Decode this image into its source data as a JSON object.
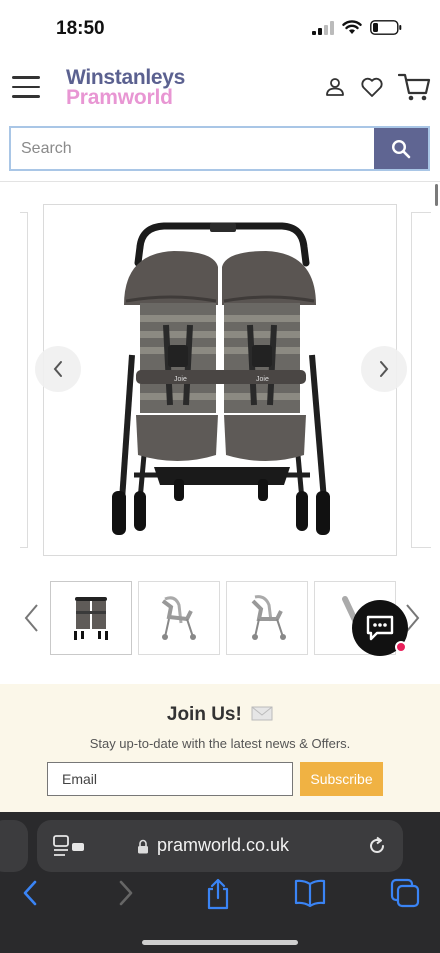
{
  "status_bar": {
    "time": "18:50"
  },
  "header": {
    "brand_line1": "Winstanleys",
    "brand_line2": "Pramworld",
    "icons": [
      "menu-icon",
      "account-icon",
      "heart-icon",
      "cart-icon"
    ]
  },
  "search": {
    "placeholder": "Search",
    "value": ""
  },
  "gallery": {
    "main_image": "Joie twin side-by-side pushchair",
    "thumbnails": [
      "thumb-front-dark",
      "thumb-side-grey-1",
      "thumb-side-grey-2",
      "thumb-folded"
    ]
  },
  "newsletter": {
    "title": "Join Us!",
    "subtitle": "Stay up-to-date with the latest news & Offers.",
    "email_placeholder": "Email",
    "subscribe_label": "Subscribe"
  },
  "browser": {
    "url": "pramworld.co.uk"
  },
  "colors": {
    "brand_navy": "#5b6190",
    "brand_pink": "#e896d3",
    "search_button": "#5f6592",
    "subscribe_button": "#f0b243",
    "newsletter_bg": "#fbf7e9",
    "browser_bg": "#2a2a2c",
    "ios_blue": "#3a84f5"
  }
}
